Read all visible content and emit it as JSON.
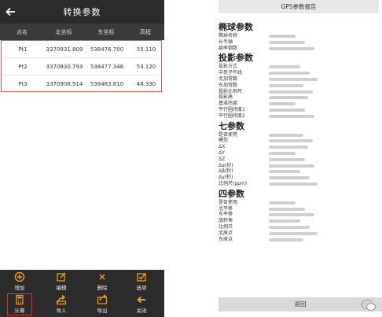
{
  "left_screen": {
    "title": "转换参数",
    "columns": [
      "点名",
      "北坐标",
      "东坐标",
      "高程"
    ],
    "rows": [
      {
        "name": "Pt1",
        "north": "3370931.809",
        "east": "538476.700",
        "height": "55.110"
      },
      {
        "name": "Pt2",
        "north": "3370930.793",
        "east": "538477.346",
        "height": "53.120"
      },
      {
        "name": "Pt3",
        "north": "3370908.914",
        "east": "538483.810",
        "height": "48.330"
      }
    ],
    "toolbar": {
      "add": "增加",
      "edit": "编辑",
      "delete": "删除",
      "options": "选项",
      "calc": "计算",
      "import": "导入",
      "export": "导出",
      "close": "关闭"
    },
    "icons": {
      "back": "back-arrow-icon",
      "add": "plus-circle-icon",
      "edit": "edit-icon",
      "delete": "x-icon",
      "options": "checkbox-icon",
      "calc": "calculator-icon",
      "import": "import-icon",
      "export": "export-icon",
      "close": "arrow-left-icon"
    },
    "colors": {
      "bar": "#2b2b2b",
      "accent": "#f39c12",
      "highlight": "#e03030"
    }
  },
  "right_screen": {
    "title": "GPS参数报告",
    "sections": [
      {
        "title": "椭球参数",
        "items": [
          "椭球名称",
          "长半轴",
          "扁率倒数"
        ]
      },
      {
        "title": "投影参数",
        "items": [
          "投影方式",
          "中央子午线",
          "北加常数",
          "东加常数",
          "投影比例尺",
          "投影高",
          "基准纬度",
          "平行圈纬度1",
          "平行圈纬度2"
        ]
      },
      {
        "title": "七参数",
        "items": [
          "是否使用",
          "模型",
          "ΔX",
          "ΔY",
          "ΔZ",
          "Δα(秒)",
          "Δβ(秒)",
          "Δγ(秒)",
          "比例尺(ppm)"
        ]
      },
      {
        "title": "四参数",
        "items": [
          "是否使用",
          "北平移",
          "东平移",
          "旋转角",
          "比例尺",
          "北原点",
          "东原点"
        ]
      }
    ],
    "return_label": "返回"
  }
}
